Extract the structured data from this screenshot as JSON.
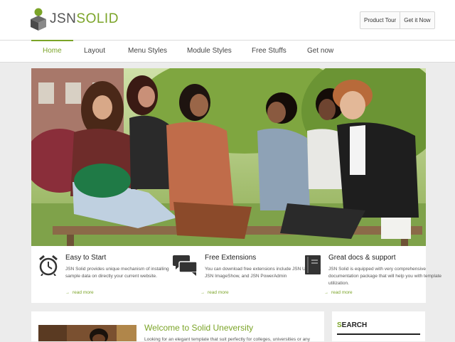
{
  "brand": {
    "logo_jsn": "JSN",
    "logo_solid": "SOLID"
  },
  "top_buttons": [
    {
      "label": "Product Tour"
    },
    {
      "label": "Get it Now"
    }
  ],
  "nav": [
    {
      "label": "Home",
      "active": true
    },
    {
      "label": "Layout"
    },
    {
      "label": "Menu Styles"
    },
    {
      "label": "Module Styles"
    },
    {
      "label": "Free Stuffs"
    },
    {
      "label": "Get now"
    }
  ],
  "features": [
    {
      "icon": "alarm-clock-icon",
      "title": "Easy to Start",
      "desc": "JSN Solid provides unique mechanism of installing sample data on directly your current website.",
      "more": "read more"
    },
    {
      "icon": "speech-bubbles-icon",
      "title": "Free Extensions",
      "desc": "You can download free extensions include JSN UniForm, JSN ImageShow, and JSN PowerAdmin",
      "more": "read more"
    },
    {
      "icon": "book-icon",
      "title": "Great docs & support",
      "desc": "JSN Solid is equipped with very comprehensive documentation package that will help you with template utilization.",
      "more": "read more"
    }
  ],
  "welcome": {
    "title": "Welcome to Solid Uneversity",
    "desc": "Looking for an elegant template that suit perfectly for colleges, universities or any"
  },
  "search": {
    "first": "S",
    "rest": "EARCH"
  },
  "colors": {
    "accent": "#7ba428",
    "page_bg": "#ececec",
    "text": "#444444"
  }
}
